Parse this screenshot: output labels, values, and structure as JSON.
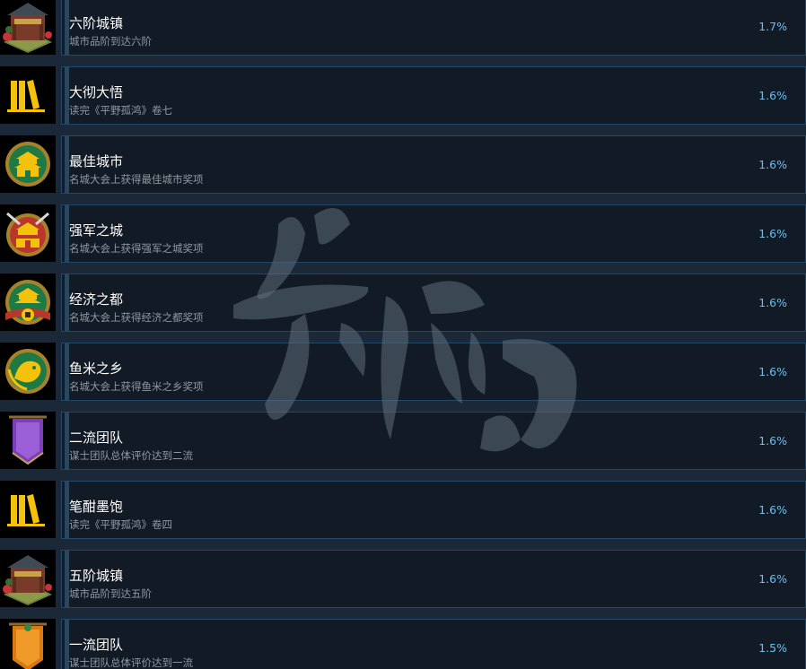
{
  "achievements": [
    {
      "title": "六阶城镇",
      "desc": "城市品阶到达六阶",
      "percent": "1.7%",
      "icon": "pavilion-town-icon"
    },
    {
      "title": "大彻大悟",
      "desc": "读完《平野孤鸿》卷七",
      "percent": "1.6%",
      "icon": "books-icon"
    },
    {
      "title": "最佳城市",
      "desc": "名城大会上获得最佳城市奖项",
      "percent": "1.6%",
      "icon": "city-medal-green-icon"
    },
    {
      "title": "强军之城",
      "desc": "名城大会上获得强军之城奖项",
      "percent": "1.6%",
      "icon": "city-medal-red-icon"
    },
    {
      "title": "经济之都",
      "desc": "名城大会上获得经济之都奖项",
      "percent": "1.6%",
      "icon": "city-medal-coin-icon"
    },
    {
      "title": "鱼米之乡",
      "desc": "名城大会上获得鱼米之乡奖项",
      "percent": "1.6%",
      "icon": "fish-medal-icon"
    },
    {
      "title": "二流团队",
      "desc": "谋士团队总体评价达到二流",
      "percent": "1.6%",
      "icon": "purple-banner-icon"
    },
    {
      "title": "笔酣墨饱",
      "desc": "读完《平野孤鸿》卷四",
      "percent": "1.6%",
      "icon": "books-icon"
    },
    {
      "title": "五阶城镇",
      "desc": "城市品阶到达五阶",
      "percent": "1.6%",
      "icon": "pavilion-town-icon"
    },
    {
      "title": "一流团队",
      "desc": "谋士团队总体评价达到一流",
      "percent": "1.5%",
      "icon": "orange-banner-icon"
    }
  ],
  "colors": {
    "background": "#1b2838",
    "card": "#121a25",
    "card_border": "#23496a",
    "percent": "#66c0f4",
    "title": "#ffffff",
    "description": "#8f98a0"
  }
}
